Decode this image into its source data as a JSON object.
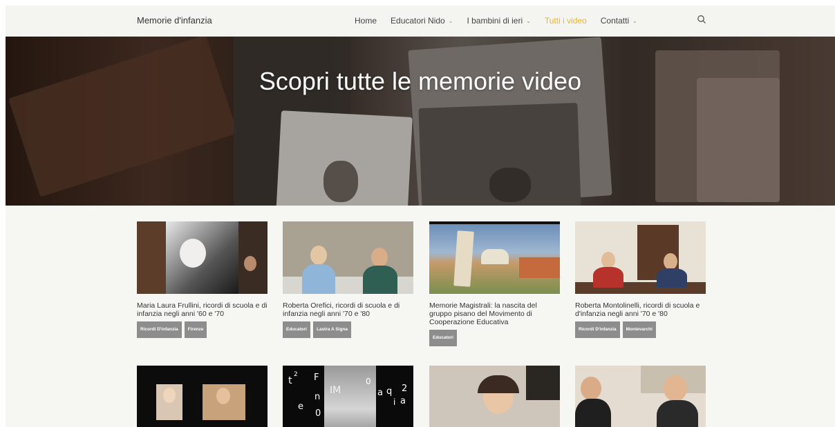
{
  "site": {
    "title": "Memorie d'infanzia"
  },
  "nav": {
    "items": [
      {
        "label": "Home",
        "has_dropdown": false,
        "active": false
      },
      {
        "label": "Educatori Nido",
        "has_dropdown": true,
        "active": false
      },
      {
        "label": "I bambini di ieri",
        "has_dropdown": true,
        "active": false
      },
      {
        "label": "Tutti i video",
        "has_dropdown": false,
        "active": true
      },
      {
        "label": "Contatti",
        "has_dropdown": true,
        "active": false
      }
    ],
    "search_icon": "search-icon",
    "accent_color": "#e8b72a"
  },
  "hero": {
    "title": "Scopri tutte le memorie video"
  },
  "videos": [
    {
      "title": "Maria Laura Frullini, ricordi di scuola e di infanzia negli anni '60 e '70",
      "tags": [
        "Ricordi D'infanzia",
        "Firenze"
      ]
    },
    {
      "title": "Roberta Orefici, ricordi di scuola e di infanzia negli anni '70 e '80",
      "tags": [
        "Educatori",
        "Lastra A Signa"
      ]
    },
    {
      "title": "Memorie Magistrali: la nascita del gruppo pisano del Movimento di Cooperazione Educativa",
      "tags": [
        "Educatori"
      ]
    },
    {
      "title": "Roberta Montolinelli, ricordi di scuola e d'infanzia negli anni '70 e '80",
      "tags": [
        "Ricordi D'infanzia",
        "Montevarchi"
      ]
    },
    {
      "title": "",
      "tags": []
    },
    {
      "title": "",
      "tags": [],
      "thumb_text": [
        "t",
        "2",
        "F",
        "n",
        "e",
        "0",
        "IM",
        "0",
        "a",
        "q",
        "2",
        "i",
        "a"
      ]
    },
    {
      "title": "",
      "tags": []
    },
    {
      "title": "",
      "tags": []
    }
  ],
  "colors": {
    "tag_bg": "#8d8d8d",
    "page_bg": "#f6f6f3"
  }
}
